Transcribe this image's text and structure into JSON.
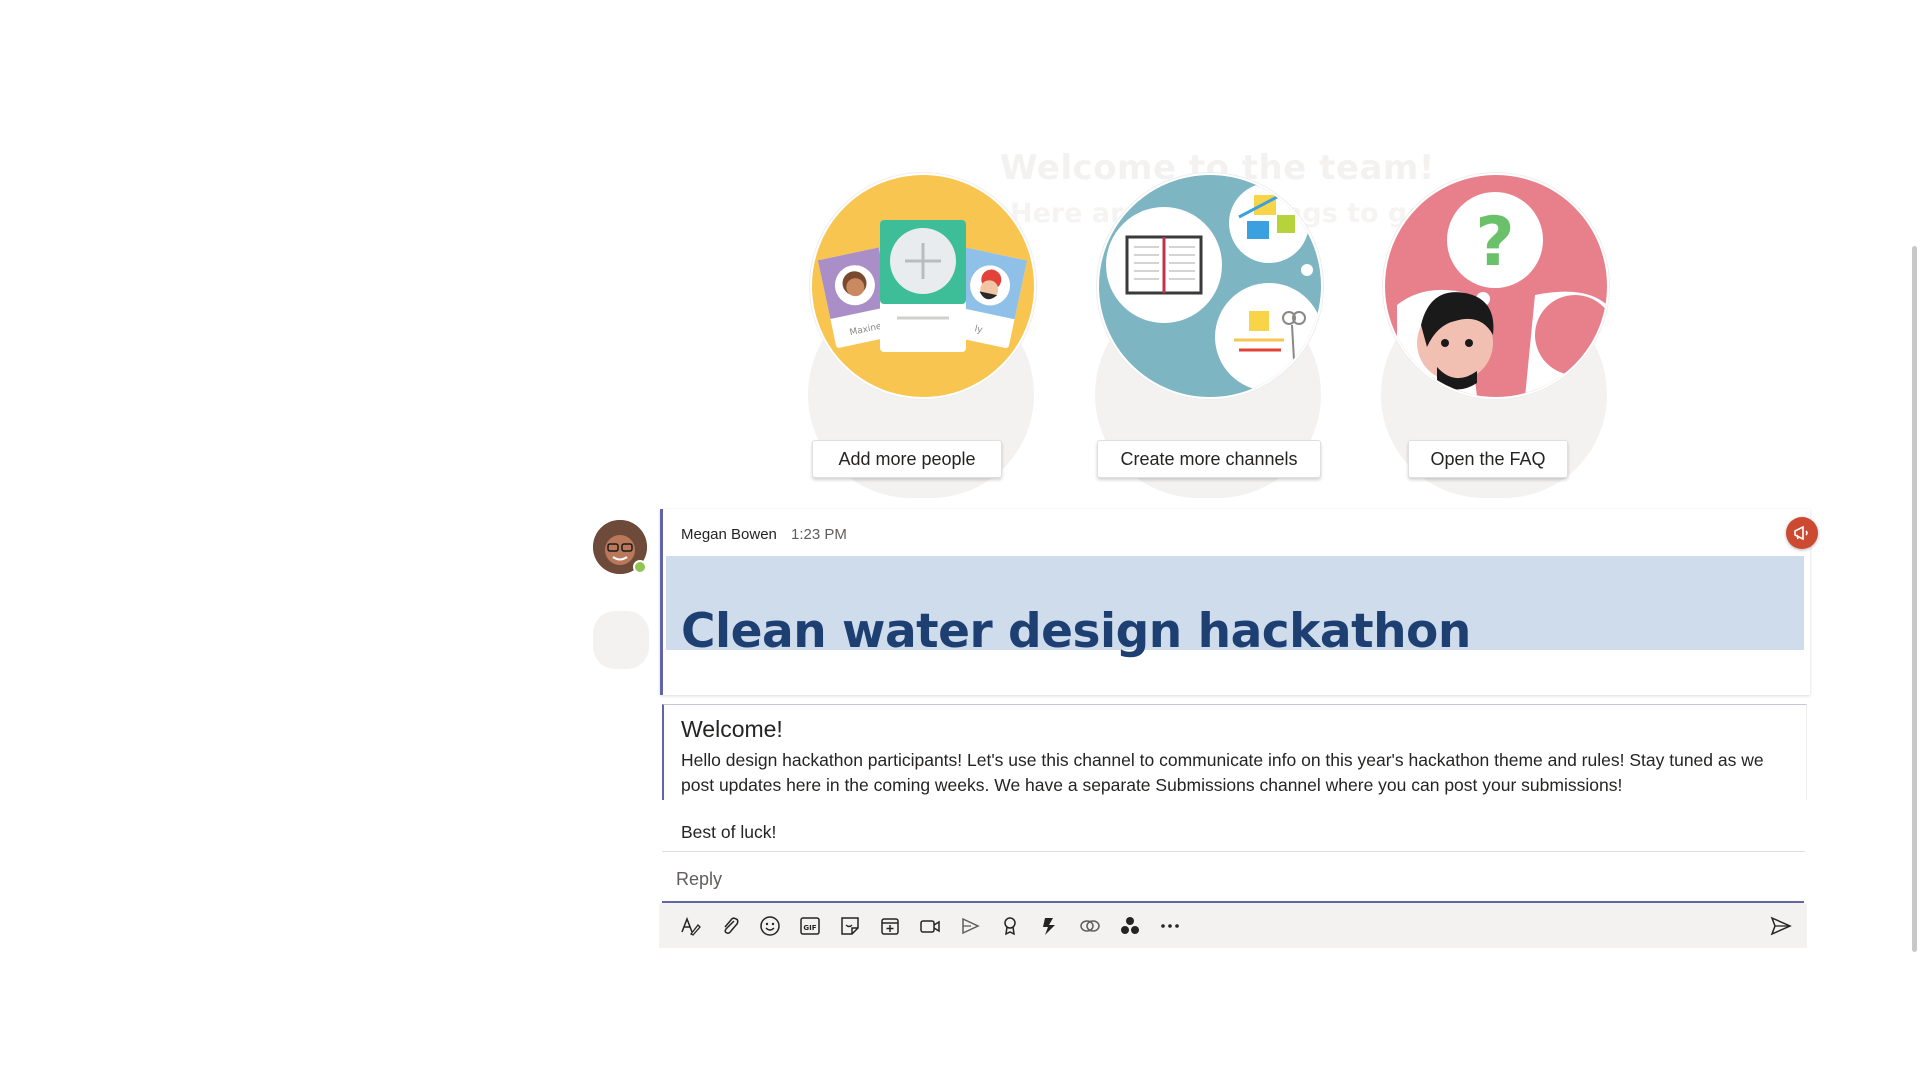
{
  "welcome": {
    "ghost_title": "Welcome to the team!",
    "ghost_subtitle": "Here are some things to get going..."
  },
  "actions": [
    {
      "label": "Add more people",
      "icon": "people-cards-icon"
    },
    {
      "label": "Create more channels",
      "icon": "notebook-icon"
    },
    {
      "label": "Open the FAQ",
      "icon": "question-mark-icon"
    }
  ],
  "illustration_text": {
    "card_name_left": "Maxine",
    "card_name_right": "ly"
  },
  "message": {
    "author": "Megan Bowen",
    "time": "1:23 PM",
    "banner_title": "Clean water design hackathon",
    "heading": "Welcome!",
    "body": "Hello design hackathon participants! Let's use this channel to communicate info on this year's hackathon theme and rules! Stay tuned as we post updates here in the coming weeks. We have a separate Submissions channel where you can post your submissions!",
    "signoff": "Best of luck!",
    "presence": "available"
  },
  "reply": {
    "placeholder": "Reply"
  },
  "toolbar": {
    "tools": [
      "format-icon",
      "attach-icon",
      "emoji-icon",
      "gif-icon",
      "sticker-icon",
      "schedule-meeting-icon",
      "meet-now-icon",
      "stream-icon",
      "praise-icon",
      "apps-icon",
      "loop-icon",
      "more-apps-icon",
      "more-options-icon"
    ],
    "send_icon": "send-icon"
  },
  "colors": {
    "accent": "#6264a7",
    "banner_bg": "#cfdcec",
    "banner_text": "#1d3f72",
    "yellow": "#f8c550",
    "teal": "#7db5c2",
    "pink": "#e8808c",
    "announce": "#cc4a31",
    "presence": "#92c353"
  }
}
